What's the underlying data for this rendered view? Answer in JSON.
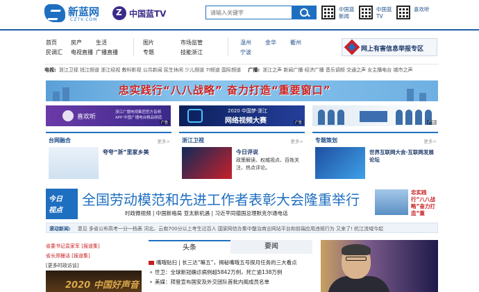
{
  "header": {
    "logo_name": "新蓝网",
    "logo_sub": "CZTV.COM",
    "tv_logo": "中国蓝TV",
    "search_placeholder": "请输入关键字",
    "qr_labels": [
      "中国蓝新闻",
      "中国蓝TV",
      "喜欢听"
    ]
  },
  "nav": {
    "group1": [
      "首页",
      "房产",
      "生活",
      "民调汇",
      "电视直播",
      "广播直播"
    ],
    "group2": [
      "图片",
      "市场监管",
      "专题",
      "技能浙江"
    ],
    "group3": [
      "温州",
      "金华",
      "衢州",
      "宁波"
    ],
    "report": "网上有害信息举报专区"
  },
  "channels": {
    "tv_label": "电视:",
    "tv_items": "浙江卫视  钱江频道  浙江经视  教科影视  公共新闻  民生休闲  少儿频道  7I频道  国际频道",
    "radio_label": "广播:",
    "radio_items": "浙江之声  新闻广播  经济广播  音乐调频  交通之声  女主播电台  城市之声"
  },
  "banner": {
    "text": "忠实践行“八八战略”  奋力打造“重要窗口”"
  },
  "ads": {
    "ad1_title": "喜欢听",
    "ad1_sub": "浙江广播电视集团官方音频APP 中国广播电台精品频道",
    "ad2_line1": "2020 中国梦·浙江",
    "ad2_line2": "网络视频大赛",
    "tag": "广告"
  },
  "columns": [
    {
      "heading": "台网融合",
      "more": "更多>",
      "title": "夸夸“浙”里家乡美",
      "desc": ""
    },
    {
      "heading": "浙江卫视",
      "more": "更多>",
      "title": "今日评说",
      "desc": "政策解读、权威视点、百姓关注、热点评论。"
    },
    {
      "heading": "专题策划",
      "more": "更多>",
      "title": "世界互联网大会·互联网发展论坛",
      "desc": ""
    }
  ],
  "headline": {
    "badge1": "今日",
    "badge2": "视点",
    "title": "全国劳动模范和先进工作者表彰大会隆重举行",
    "sublinks": "时政微视频 | 中国新格局 亚太新机遇 | 习近平同德国总理默克尔通电话",
    "side_text": "忠实践行“八八战略”奋力打造“重"
  },
  "ticker": {
    "label": "滚动新闻:",
    "text": "意见    多省公布高考一分一档表 河北、云南700分以上考生过百人    国家网信办集中整治商业网站平台和前端应用违规行为    又来了! 杭江流域今起"
  },
  "leftlist": {
    "items": [
      "省委书记袁家军 [报道集]",
      "省长郑栅洁 [报道集]",
      "[更多时政访谈]"
    ],
    "img_text": "2020 中国好声音"
  },
  "tabs": {
    "active": "头条",
    "other": "要闻"
  },
  "news": [
    "嘴哦贴扫 | 长三达“嘛五”，揭秘嘴哦五号探月任务的三大看点",
    "世卫：全球新冠确诊病例超5842万例，死亡逾138万例",
    "美媒：拜登宣布国安及外交团队首批内阁成员名单"
  ]
}
